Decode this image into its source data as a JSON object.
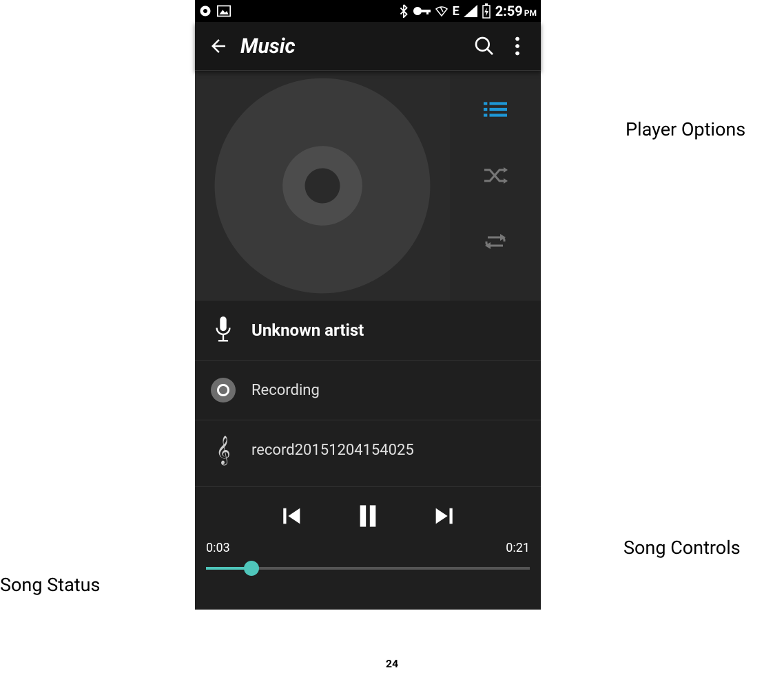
{
  "status_bar": {
    "time": "2:59",
    "time_suffix": "PM",
    "network_label": "E"
  },
  "app_bar": {
    "title": "Music"
  },
  "track": {
    "artist": "Unknown artist",
    "album": "Recording",
    "song": "record20151204154025"
  },
  "playback": {
    "elapsed": "0:03",
    "total": "0:21",
    "progress_percent": 14
  },
  "annotations": {
    "player_options": "Player Options",
    "song_controls": "Song Controls",
    "song_status": "Song Status"
  },
  "page_number": "24"
}
